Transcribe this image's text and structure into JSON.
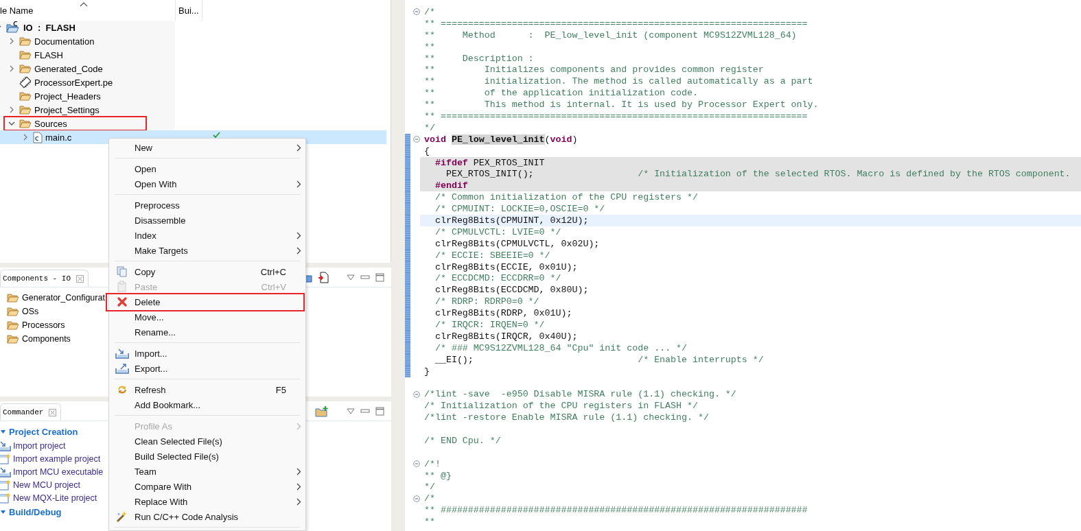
{
  "explorer": {
    "columns": [
      "le Name",
      "Bui..."
    ],
    "tree": [
      {
        "label": "IO  :  FLASH",
        "kind": "project",
        "expanded": true,
        "selected": false,
        "built": false,
        "framed": false,
        "children": [
          {
            "label": "Documentation",
            "kind": "folder",
            "expanded": false,
            "selected": false,
            "built": false,
            "framed": false
          },
          {
            "label": "FLASH",
            "kind": "folder",
            "selected": false,
            "built": false,
            "framed": false
          },
          {
            "label": "Generated_Code",
            "kind": "folder",
            "expanded": false,
            "selected": false,
            "built": false,
            "framed": false
          },
          {
            "label": "ProcessorExpert.pe",
            "kind": "chip",
            "selected": false,
            "built": false,
            "framed": false
          },
          {
            "label": "Project_Headers",
            "kind": "folder",
            "selected": false,
            "built": false,
            "framed": false
          },
          {
            "label": "Project_Settings",
            "kind": "folder",
            "expanded": false,
            "selected": false,
            "built": false,
            "framed": false
          },
          {
            "label": "Sources",
            "kind": "folder",
            "expanded": true,
            "selected": false,
            "built": false,
            "framed": true,
            "children": [
              {
                "label": "main.c",
                "kind": "cfile",
                "expanded": false,
                "selected": true,
                "built": true,
                "framed": false
              }
            ]
          }
        ]
      }
    ]
  },
  "components_view": {
    "tab": "Components - IO",
    "items": [
      "Generator_Configurat",
      "OSs",
      "Processors",
      "Components"
    ]
  },
  "commander_view": {
    "tab": "Commander",
    "sections": [
      {
        "title": "Project Creation",
        "expanded": true,
        "items": [
          {
            "label": "Import project",
            "kind": "import"
          },
          {
            "label": "Import example project",
            "kind": "new"
          },
          {
            "label": "Import MCU executable",
            "kind": "import"
          },
          {
            "label": "New MCU project",
            "kind": "new"
          },
          {
            "label": "New MQX-Lite project",
            "kind": "new"
          }
        ]
      },
      {
        "title": "Build/Debug",
        "expanded": true
      }
    ]
  },
  "context_menu": {
    "items": [
      {
        "kind": "plain",
        "label": "New",
        "submenu": true,
        "disabled": false,
        "framed": false
      },
      {
        "kind": "separator"
      },
      {
        "kind": "plain",
        "label": "Open",
        "submenu": false,
        "disabled": false,
        "framed": false
      },
      {
        "kind": "plain",
        "label": "Open With",
        "submenu": true,
        "disabled": false,
        "framed": false
      },
      {
        "kind": "separator"
      },
      {
        "kind": "plain",
        "label": "Preprocess",
        "submenu": false,
        "disabled": false,
        "framed": false
      },
      {
        "kind": "plain",
        "label": "Disassemble",
        "submenu": false,
        "disabled": false,
        "framed": false
      },
      {
        "kind": "plain",
        "label": "Index",
        "submenu": true,
        "disabled": false,
        "framed": false
      },
      {
        "kind": "plain",
        "label": "Make Targets",
        "submenu": true,
        "disabled": false,
        "framed": false
      },
      {
        "kind": "separator"
      },
      {
        "kind": "copy",
        "label": "Copy",
        "shortcut": "Ctrl+C",
        "submenu": false,
        "disabled": false,
        "framed": false
      },
      {
        "kind": "paste",
        "label": "Paste",
        "shortcut": "Ctrl+V",
        "submenu": false,
        "disabled": true,
        "framed": false
      },
      {
        "kind": "delete",
        "label": "Delete",
        "submenu": false,
        "disabled": false,
        "framed": true
      },
      {
        "kind": "plain",
        "label": "Move...",
        "submenu": false,
        "disabled": false,
        "framed": false
      },
      {
        "kind": "plain",
        "label": "Rename...",
        "submenu": false,
        "disabled": false,
        "framed": false
      },
      {
        "kind": "separator"
      },
      {
        "kind": "import",
        "label": "Import...",
        "submenu": false,
        "disabled": false,
        "framed": false
      },
      {
        "kind": "export",
        "label": "Export...",
        "submenu": false,
        "disabled": false,
        "framed": false
      },
      {
        "kind": "separator"
      },
      {
        "kind": "refresh",
        "label": "Refresh",
        "shortcut": "F5",
        "submenu": false,
        "disabled": false,
        "framed": false
      },
      {
        "kind": "plain",
        "label": "Add Bookmark...",
        "submenu": false,
        "disabled": false,
        "framed": false
      },
      {
        "kind": "separator"
      },
      {
        "kind": "plain",
        "label": "Profile As",
        "submenu": true,
        "disabled": true,
        "framed": false
      },
      {
        "kind": "plain",
        "label": "Clean Selected File(s)",
        "submenu": false,
        "disabled": false,
        "framed": false
      },
      {
        "kind": "plain",
        "label": "Build Selected File(s)",
        "submenu": false,
        "disabled": false,
        "framed": false
      },
      {
        "kind": "plain",
        "label": "Team",
        "submenu": true,
        "disabled": false,
        "framed": false
      },
      {
        "kind": "plain",
        "label": "Compare With",
        "submenu": true,
        "disabled": false,
        "framed": false
      },
      {
        "kind": "plain",
        "label": "Replace With",
        "submenu": true,
        "disabled": false,
        "framed": false
      },
      {
        "kind": "analysis",
        "label": "Run C/C++ Code Analysis",
        "submenu": false,
        "disabled": false,
        "framed": false
      },
      {
        "kind": "separator"
      }
    ]
  },
  "editor": {
    "lines": [
      {
        "segments": [
          {
            "text": "/*",
            "kind": "comment"
          }
        ],
        "fold": true,
        "shaded": false,
        "current": false,
        "changed": false
      },
      {
        "segments": [
          {
            "text": "** ===================================================================",
            "kind": "comment"
          }
        ],
        "fold": false,
        "shaded": false,
        "current": false,
        "changed": false
      },
      {
        "segments": [
          {
            "text": "**     Method      :  PE_low_level_init (component MC9S12ZVML128_64)",
            "kind": "comment"
          }
        ],
        "fold": false,
        "shaded": false,
        "current": false,
        "changed": false
      },
      {
        "segments": [
          {
            "text": "**",
            "kind": "comment"
          }
        ],
        "fold": false,
        "shaded": false,
        "current": false,
        "changed": false
      },
      {
        "segments": [
          {
            "text": "**     Description :",
            "kind": "comment"
          }
        ],
        "fold": false,
        "shaded": false,
        "current": false,
        "changed": false
      },
      {
        "segments": [
          {
            "text": "**         Initializes components and provides common register",
            "kind": "comment"
          }
        ],
        "fold": false,
        "shaded": false,
        "current": false,
        "changed": false
      },
      {
        "segments": [
          {
            "text": "**         initialization. The method is called automatically as a part",
            "kind": "comment"
          }
        ],
        "fold": false,
        "shaded": false,
        "current": false,
        "changed": false
      },
      {
        "segments": [
          {
            "text": "**         of the application initialization code.",
            "kind": "comment"
          }
        ],
        "fold": false,
        "shaded": false,
        "current": false,
        "changed": false
      },
      {
        "segments": [
          {
            "text": "**         This method is internal. It is used by Processor Expert only.",
            "kind": "comment"
          }
        ],
        "fold": false,
        "shaded": false,
        "current": false,
        "changed": false
      },
      {
        "segments": [
          {
            "text": "** ===================================================================",
            "kind": "comment"
          }
        ],
        "fold": false,
        "shaded": false,
        "current": false,
        "changed": false
      },
      {
        "segments": [
          {
            "text": "*/",
            "kind": "comment"
          }
        ],
        "fold": false,
        "shaded": false,
        "current": false,
        "changed": false
      },
      {
        "segments": [
          {
            "text": "void ",
            "kind": "keyword"
          },
          {
            "text": "PE_low_level_init",
            "kind": "mark"
          },
          {
            "text": "(",
            "kind": "code"
          },
          {
            "text": "void",
            "kind": "keyword"
          },
          {
            "text": ")",
            "kind": "code"
          }
        ],
        "fold": true,
        "shaded": false,
        "current": false,
        "changed": true
      },
      {
        "segments": [
          {
            "text": "{",
            "kind": "code"
          }
        ],
        "fold": false,
        "shaded": false,
        "current": false,
        "changed": true
      },
      {
        "segments": [
          {
            "text": "  #ifdef",
            "kind": "keyword"
          },
          {
            "text": " PEX_RTOS_INIT",
            "kind": "code"
          }
        ],
        "fold": false,
        "shaded": true,
        "current": false,
        "changed": true
      },
      {
        "segments": [
          {
            "text": "    PEX_RTOS_INIT();                   ",
            "kind": "code"
          },
          {
            "text": "/* Initialization of the selected RTOS. Macro is defined by the RTOS component.",
            "kind": "comment"
          }
        ],
        "fold": false,
        "shaded": true,
        "current": false,
        "changed": true
      },
      {
        "segments": [
          {
            "text": "  #endif",
            "kind": "keyword"
          }
        ],
        "fold": false,
        "shaded": true,
        "current": false,
        "changed": true
      },
      {
        "segments": [
          {
            "text": "  /* Common initialization of the CPU registers */",
            "kind": "comment"
          }
        ],
        "fold": false,
        "shaded": false,
        "current": false,
        "changed": true
      },
      {
        "segments": [
          {
            "text": "  /* CPMUINT: LOCKIE=0,OSCIE=0 */",
            "kind": "comment"
          }
        ],
        "fold": false,
        "shaded": false,
        "current": false,
        "changed": true
      },
      {
        "segments": [
          {
            "text": "  clrReg8Bits(CPMUINT, 0x12U);",
            "kind": "code"
          }
        ],
        "fold": false,
        "shaded": false,
        "current": true,
        "changed": true
      },
      {
        "segments": [
          {
            "text": "  /* CPMULVCTL: LVIE=0 */",
            "kind": "comment"
          }
        ],
        "fold": false,
        "shaded": false,
        "current": false,
        "changed": true
      },
      {
        "segments": [
          {
            "text": "  clrReg8Bits(CPMULVCTL, 0x02U);",
            "kind": "code"
          }
        ],
        "fold": false,
        "shaded": false,
        "current": false,
        "changed": true
      },
      {
        "segments": [
          {
            "text": "  /* ECCIE: SBEEIE=0 */",
            "kind": "comment"
          }
        ],
        "fold": false,
        "shaded": false,
        "current": false,
        "changed": true
      },
      {
        "segments": [
          {
            "text": "  clrReg8Bits(ECCIE, 0x01U);",
            "kind": "code"
          }
        ],
        "fold": false,
        "shaded": false,
        "current": false,
        "changed": true
      },
      {
        "segments": [
          {
            "text": "  /* ECCDCMD: ECCDRR=0 */",
            "kind": "comment"
          }
        ],
        "fold": false,
        "shaded": false,
        "current": false,
        "changed": true
      },
      {
        "segments": [
          {
            "text": "  clrReg8Bits(ECCDCMD, 0x80U);",
            "kind": "code"
          }
        ],
        "fold": false,
        "shaded": false,
        "current": false,
        "changed": true
      },
      {
        "segments": [
          {
            "text": "  /* RDRP: RDRP0=0 */",
            "kind": "comment"
          }
        ],
        "fold": false,
        "shaded": false,
        "current": false,
        "changed": true
      },
      {
        "segments": [
          {
            "text": "  clrReg8Bits(RDRP, 0x01U);",
            "kind": "code"
          }
        ],
        "fold": false,
        "shaded": false,
        "current": false,
        "changed": true
      },
      {
        "segments": [
          {
            "text": "  /* IRQCR: IRQEN=0 */",
            "kind": "comment"
          }
        ],
        "fold": false,
        "shaded": false,
        "current": false,
        "changed": true
      },
      {
        "segments": [
          {
            "text": "  clrReg8Bits(IRQCR, 0x40U);",
            "kind": "code"
          }
        ],
        "fold": false,
        "shaded": false,
        "current": false,
        "changed": true
      },
      {
        "segments": [
          {
            "text": "  /* ### MC9S12ZVML128_64 \"Cpu\" init code ... */",
            "kind": "comment"
          }
        ],
        "fold": false,
        "shaded": false,
        "current": false,
        "changed": true
      },
      {
        "segments": [
          {
            "text": "  __EI();                              ",
            "kind": "code"
          },
          {
            "text": "/* Enable interrupts */",
            "kind": "comment"
          }
        ],
        "fold": false,
        "shaded": false,
        "current": false,
        "changed": true
      },
      {
        "segments": [
          {
            "text": "}",
            "kind": "code"
          }
        ],
        "fold": false,
        "shaded": false,
        "current": false,
        "changed": true
      },
      {
        "fold": false,
        "shaded": false,
        "current": false,
        "changed": false
      },
      {
        "segments": [
          {
            "text": "/*lint -save  -e950 Disable MISRA rule (1.1) checking. */",
            "kind": "comment"
          }
        ],
        "fold": true,
        "shaded": false,
        "current": false,
        "changed": false
      },
      {
        "segments": [
          {
            "text": "/* Initialization of the CPU registers in FLASH */",
            "kind": "comment"
          }
        ],
        "fold": false,
        "shaded": false,
        "current": false,
        "changed": false
      },
      {
        "segments": [
          {
            "text": "/*lint -restore Enable MISRA rule (1.1) checking. */",
            "kind": "comment"
          }
        ],
        "fold": false,
        "shaded": false,
        "current": false,
        "changed": false
      },
      {
        "fold": false,
        "shaded": false,
        "current": false,
        "changed": false
      },
      {
        "segments": [
          {
            "text": "/* END Cpu. */",
            "kind": "comment"
          }
        ],
        "fold": false,
        "shaded": false,
        "current": false,
        "changed": false
      },
      {
        "fold": false,
        "shaded": false,
        "current": false,
        "changed": false
      },
      {
        "segments": [
          {
            "text": "/*!",
            "kind": "comment"
          }
        ],
        "fold": true,
        "shaded": false,
        "current": false,
        "changed": false
      },
      {
        "segments": [
          {
            "text": "** @}",
            "kind": "comment"
          }
        ],
        "fold": false,
        "shaded": false,
        "current": false,
        "changed": false
      },
      {
        "segments": [
          {
            "text": "*/",
            "kind": "comment"
          }
        ],
        "fold": false,
        "shaded": false,
        "current": false,
        "changed": false
      },
      {
        "segments": [
          {
            "text": "/*",
            "kind": "comment"
          }
        ],
        "fold": true,
        "shaded": false,
        "current": false,
        "changed": false
      },
      {
        "segments": [
          {
            "text": "** ###################################################################",
            "kind": "comment"
          }
        ],
        "fold": false,
        "shaded": false,
        "current": false,
        "changed": false
      },
      {
        "segments": [
          {
            "text": "**",
            "kind": "comment"
          }
        ],
        "fold": false,
        "shaded": false,
        "current": false,
        "changed": false
      }
    ]
  }
}
